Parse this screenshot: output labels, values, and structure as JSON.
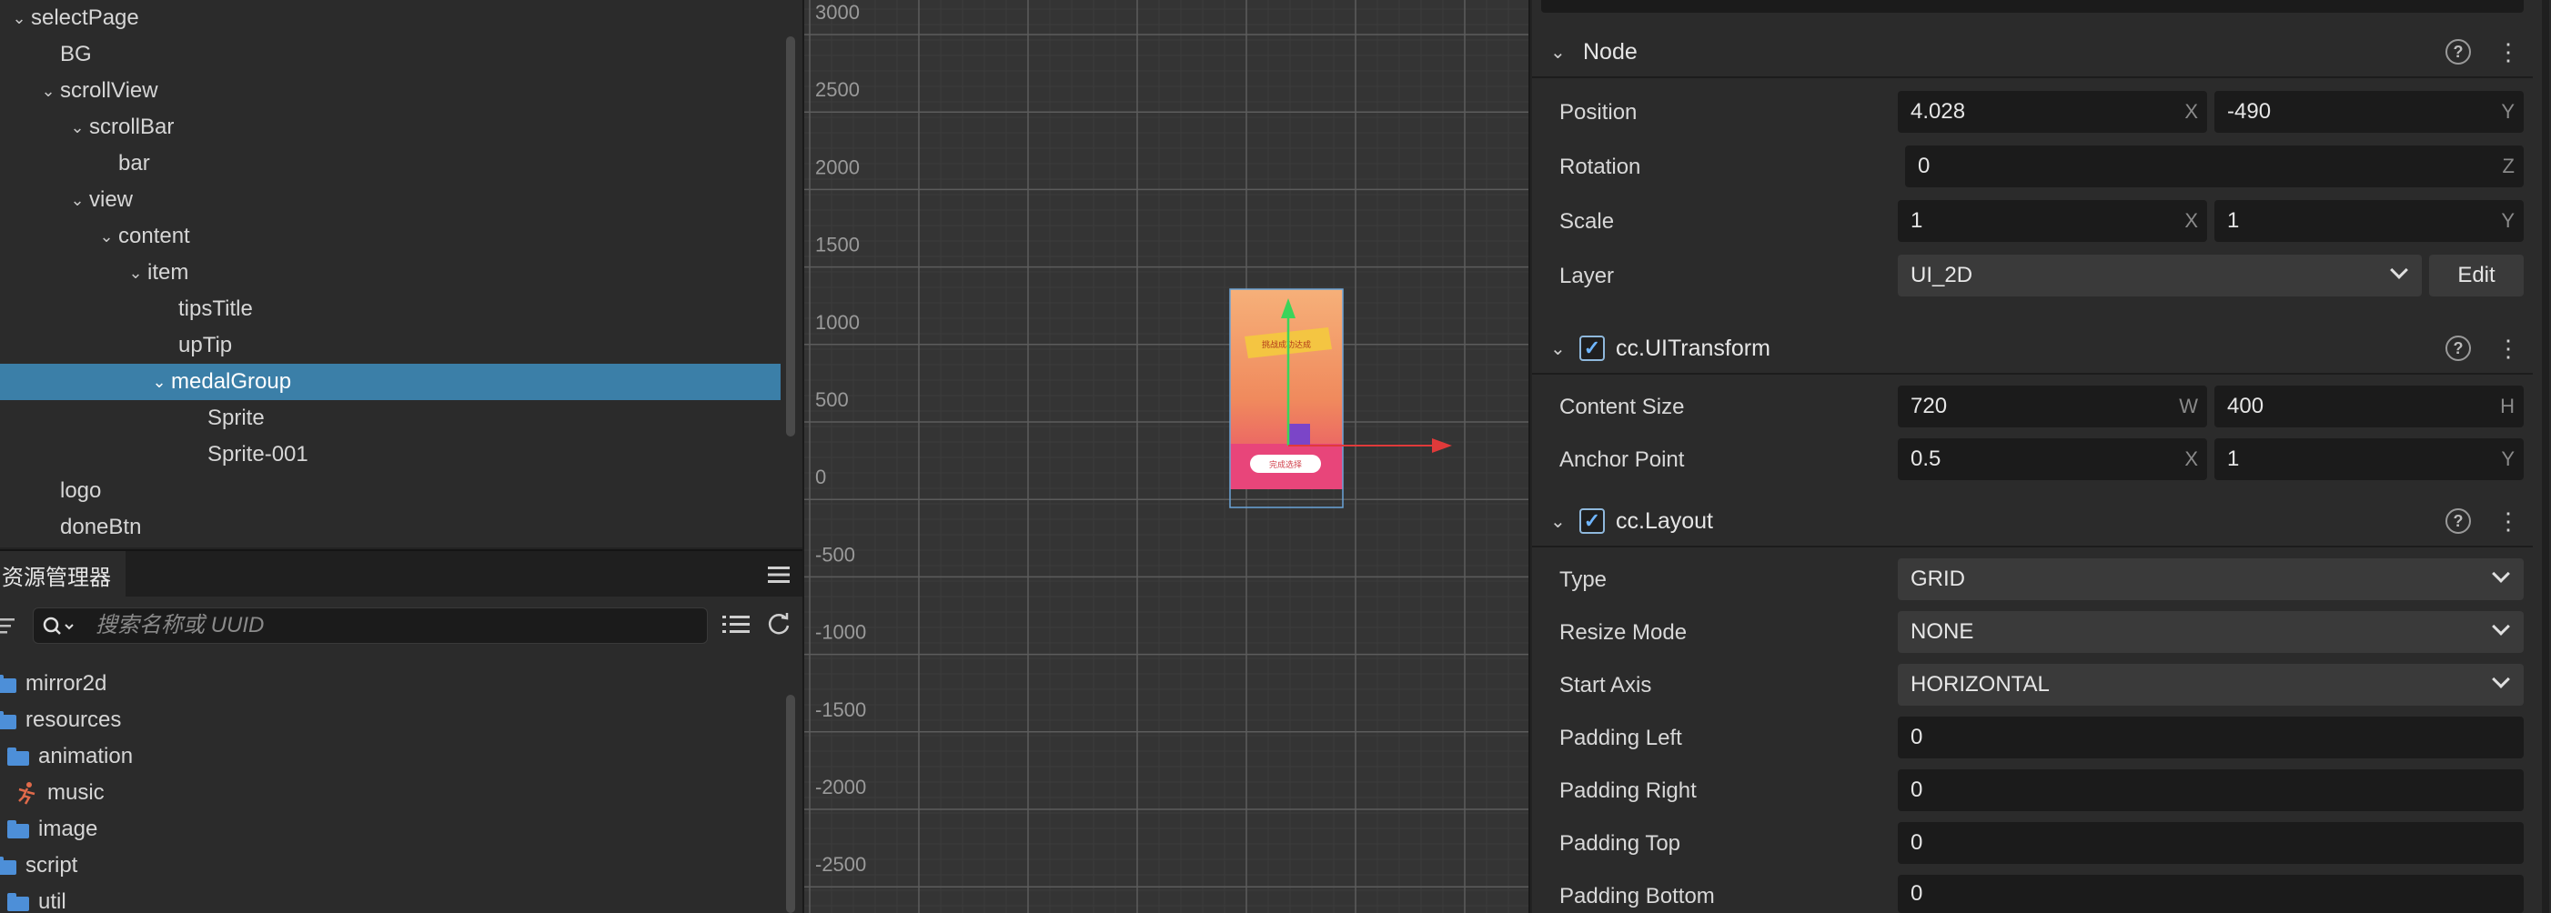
{
  "hierarchy": {
    "nodes": [
      {
        "label": "selectPage",
        "expanded": true
      },
      {
        "label": "BG",
        "expanded": null
      },
      {
        "label": "scrollView",
        "expanded": true
      },
      {
        "label": "scrollBar",
        "expanded": true
      },
      {
        "label": "bar",
        "expanded": null
      },
      {
        "label": "view",
        "expanded": true
      },
      {
        "label": "content",
        "expanded": true
      },
      {
        "label": "item",
        "expanded": true
      },
      {
        "label": "tipsTitle",
        "expanded": null
      },
      {
        "label": "upTip",
        "expanded": null
      },
      {
        "label": "medalGroup",
        "expanded": true,
        "selected": true
      },
      {
        "label": "Sprite",
        "expanded": null
      },
      {
        "label": "Sprite-001",
        "expanded": null
      },
      {
        "label": "logo",
        "expanded": null
      },
      {
        "label": "doneBtn",
        "expanded": null
      }
    ]
  },
  "assets": {
    "tab_label": "资源管理器",
    "search_placeholder": "搜索名称或 UUID",
    "items": [
      {
        "label": "mirror2d",
        "icon": "folder-icon"
      },
      {
        "label": "resources",
        "icon": "folder-icon"
      },
      {
        "label": "animation",
        "icon": "folder-icon"
      },
      {
        "label": "music",
        "icon": "audio-icon"
      },
      {
        "label": "image",
        "icon": "folder-icon"
      },
      {
        "label": "script",
        "icon": "folder-icon"
      },
      {
        "label": "util",
        "icon": "folder-icon"
      }
    ]
  },
  "scene": {
    "y_labels": [
      "3000",
      "2500",
      "2000",
      "1500",
      "1000",
      "500",
      "0",
      "-500",
      "-1000",
      "-1500",
      "-2000",
      "-2500"
    ],
    "preview_banner_text": "挑战成功达成",
    "preview_button_text": "完成选择"
  },
  "inspector": {
    "node": {
      "title": "Node",
      "position_label": "Position",
      "position_x": "4.028",
      "position_y": "-490",
      "rotation_label": "Rotation",
      "rotation_z": "0",
      "scale_label": "Scale",
      "scale_x": "1",
      "scale_y": "1",
      "layer_label": "Layer",
      "layer_value": "UI_2D",
      "edit_label": "Edit"
    },
    "uitransform": {
      "title": "cc.UITransform",
      "content_size_label": "Content Size",
      "width": "720",
      "height": "400",
      "anchor_label": "Anchor Point",
      "anchor_x": "0.5",
      "anchor_y": "1"
    },
    "layout": {
      "title": "cc.Layout",
      "type_label": "Type",
      "type_value": "GRID",
      "resize_label": "Resize Mode",
      "resize_value": "NONE",
      "start_axis_label": "Start Axis",
      "start_axis_value": "HORIZONTAL",
      "padding_left_label": "Padding Left",
      "padding_left": "0",
      "padding_right_label": "Padding Right",
      "padding_right": "0",
      "padding_top_label": "Padding Top",
      "padding_top": "0",
      "padding_bottom_label": "Padding Bottom",
      "padding_bottom": "0"
    },
    "axis_letters": {
      "x": "X",
      "y": "Y",
      "z": "Z",
      "w": "W",
      "h": "H"
    }
  }
}
